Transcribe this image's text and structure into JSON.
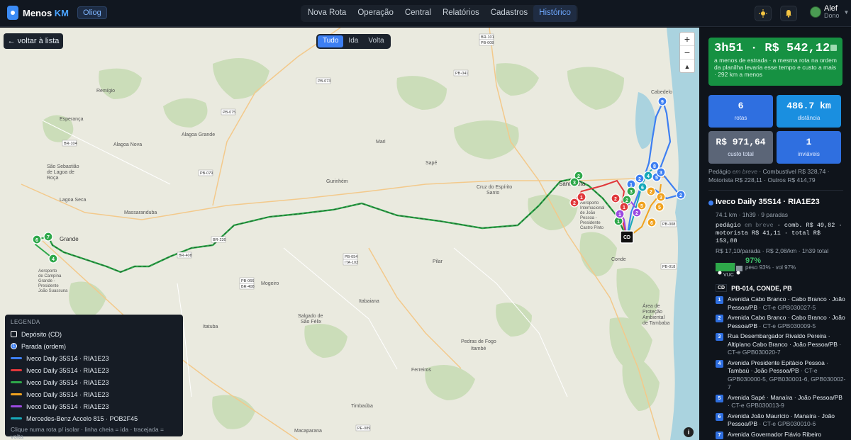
{
  "header": {
    "brand": "Menos",
    "brand_accent": "KM",
    "tenant": "Oliog",
    "nav": [
      "Nova Rota",
      "Operação",
      "Central",
      "Relatórios",
      "Cadastros",
      "Histórico"
    ],
    "nav_active": "Histórico",
    "theme_icon": "sun-icon",
    "notifications_icon": "bell-icon",
    "user": {
      "name": "Alef",
      "role": "Dono"
    }
  },
  "map": {
    "back_label": "← voltar à lista",
    "direction_toggle": [
      "Tudo",
      "Ida",
      "Volta"
    ],
    "direction_selected": "Tudo",
    "zoom_in": "+",
    "zoom_out": "−",
    "compass": "▲",
    "info": "i",
    "places": [
      {
        "name": "Remígio"
      },
      {
        "name": "Esperança"
      },
      {
        "name": "Alagoa Grande"
      },
      {
        "name": "Alagoa Nova"
      },
      {
        "name": "São Sebastião de Lagoa de Roça"
      },
      {
        "name": "Lagoa Seca"
      },
      {
        "name": "Massaranduba"
      },
      {
        "name": "Gurinhém"
      },
      {
        "name": "Sapé"
      },
      {
        "name": "Mari"
      },
      {
        "name": "Cruz do Espírito Santo"
      },
      {
        "name": "Santa Rita"
      },
      {
        "name": "Campina Grande"
      },
      {
        "name": "Mogeiro"
      },
      {
        "name": "Itabaiana"
      },
      {
        "name": "Salgado de São Félix"
      },
      {
        "name": "Pilar"
      },
      {
        "name": "Itatuba"
      },
      {
        "name": "Pedras de Fogo"
      },
      {
        "name": "Itambé"
      },
      {
        "name": "Ferreiros"
      },
      {
        "name": "Timbaúba"
      },
      {
        "name": "Macaparana"
      },
      {
        "name": "Conde"
      },
      {
        "name": "Área de Proteção Ambiental de Tambaba"
      },
      {
        "name": "Cabedelo"
      },
      {
        "name": "Aeroporto Internacional de João Pessoa - Presidente Castro Pinto"
      },
      {
        "name": "Aeroporto de Campina Grande - Presidente João Suassuna"
      }
    ],
    "road_labels": [
      "BR-101",
      "PB-041",
      "PB-073",
      "PB-075",
      "BR-104",
      "BR-230",
      "PB-079",
      "PB-054",
      "ITA-102",
      "PB-066",
      "BR-408",
      "PE-089",
      "PB-008",
      "PB-018",
      "BR-408"
    ],
    "depot_label": "CD"
  },
  "legend": {
    "title": "LEGENDA",
    "depot": "Depósito (CD)",
    "stop": "Parada (ordem)",
    "routes": [
      {
        "label": "Iveco Daily 35S14 · RIA1E23",
        "color": "#3d7ff2"
      },
      {
        "label": "Iveco Daily 35S14 · RIA1E23",
        "color": "#e0383b"
      },
      {
        "label": "Iveco Daily 35S14 · RIA1E23",
        "color": "#2ea84a"
      },
      {
        "label": "Iveco Daily 35S14 · RIA1E23",
        "color": "#f0a21f"
      },
      {
        "label": "Iveco Daily 35S14 · RIA1E23",
        "color": "#9b4ae0"
      },
      {
        "label": "Mercedes-Benz Accelo 815 · POB2F45",
        "color": "#17a8b8"
      }
    ],
    "note": "Clique numa rota p/ isolar · linha cheia = ida · tracejada = volta"
  },
  "summary": {
    "headline": "3h51 · R$ 542,12",
    "headline_sub": "a menos de estrada · a mesma rota na ordem da planilha levaria esse tempo e custo a mais · 292 km a menos",
    "stats": [
      {
        "value": "6",
        "label": "rotas",
        "color": "#2f6fe0"
      },
      {
        "value": "486.7 km",
        "label": "distância",
        "color": "#1a8fe0"
      },
      {
        "value": "R$ 971,64",
        "label": "custo total",
        "color": "#5b6577"
      },
      {
        "value": "1",
        "label": "inviáveis",
        "color": "#2f6fe0"
      }
    ],
    "costs_prefix": "Pedágio ",
    "costs_soon": "em breve",
    "costs_rest": " · Combustível R$ 328,74 · Motorista R$ 228,11 · Outros R$ 414,79"
  },
  "vehicle": {
    "title": "Iveco Daily 35S14 · RIA1E23",
    "color": "#3d7ff2",
    "meta": "74.1 km · 1h39 · 9 paradas",
    "cost_prefix": "pedágio ",
    "cost_soon": "em breve",
    "cost_rest": " · comb. R$ 49,82 · motorista R$ 41,11 · total R$ 153,88",
    "rate": "R$ 17,10/parada · R$ 2,08/km · 1h39 total",
    "occupancy": "97%",
    "occupancy_fraction": 0.97,
    "occupancy_detail": "peso 93% · vol 97%",
    "vuc": "VUC",
    "cd_tag": "CD",
    "cd_address": "PB-014, CONDE, PB",
    "stops": [
      {
        "n": "1",
        "addr": "Avenida Cabo Branco · Cabo Branco · João Pessoa/PB",
        "ct": " · CT-e GPB030027-5"
      },
      {
        "n": "2",
        "addr": "Avenida Cabo Branco · Cabo Branco · João Pessoa/PB",
        "ct": " · CT-e GPB030009-5"
      },
      {
        "n": "3",
        "addr": "Rua Desembargador Rivaldo Pereira · Altiplano Cabo Branco · João Pessoa/PB",
        "ct": " · CT-e GPB030020-7"
      },
      {
        "n": "4",
        "addr": "Avenida Presidente Epitácio Pessoa · Tambaú · João Pessoa/PB",
        "ct": " · CT-e GPB030000-5, GPB030001-6, GPB030002-7"
      },
      {
        "n": "5",
        "addr": "Avenida Sapé · Manaíra · João Pessoa/PB",
        "ct": " · CT-e GPB030013-9"
      },
      {
        "n": "6",
        "addr": "Avenida João Maurício · Manaíra · João Pessoa/PB",
        "ct": " · CT-e GPB030010-6"
      },
      {
        "n": "7",
        "addr": "Avenida Governador Flávio Ribeiro",
        "ct": ""
      }
    ]
  }
}
